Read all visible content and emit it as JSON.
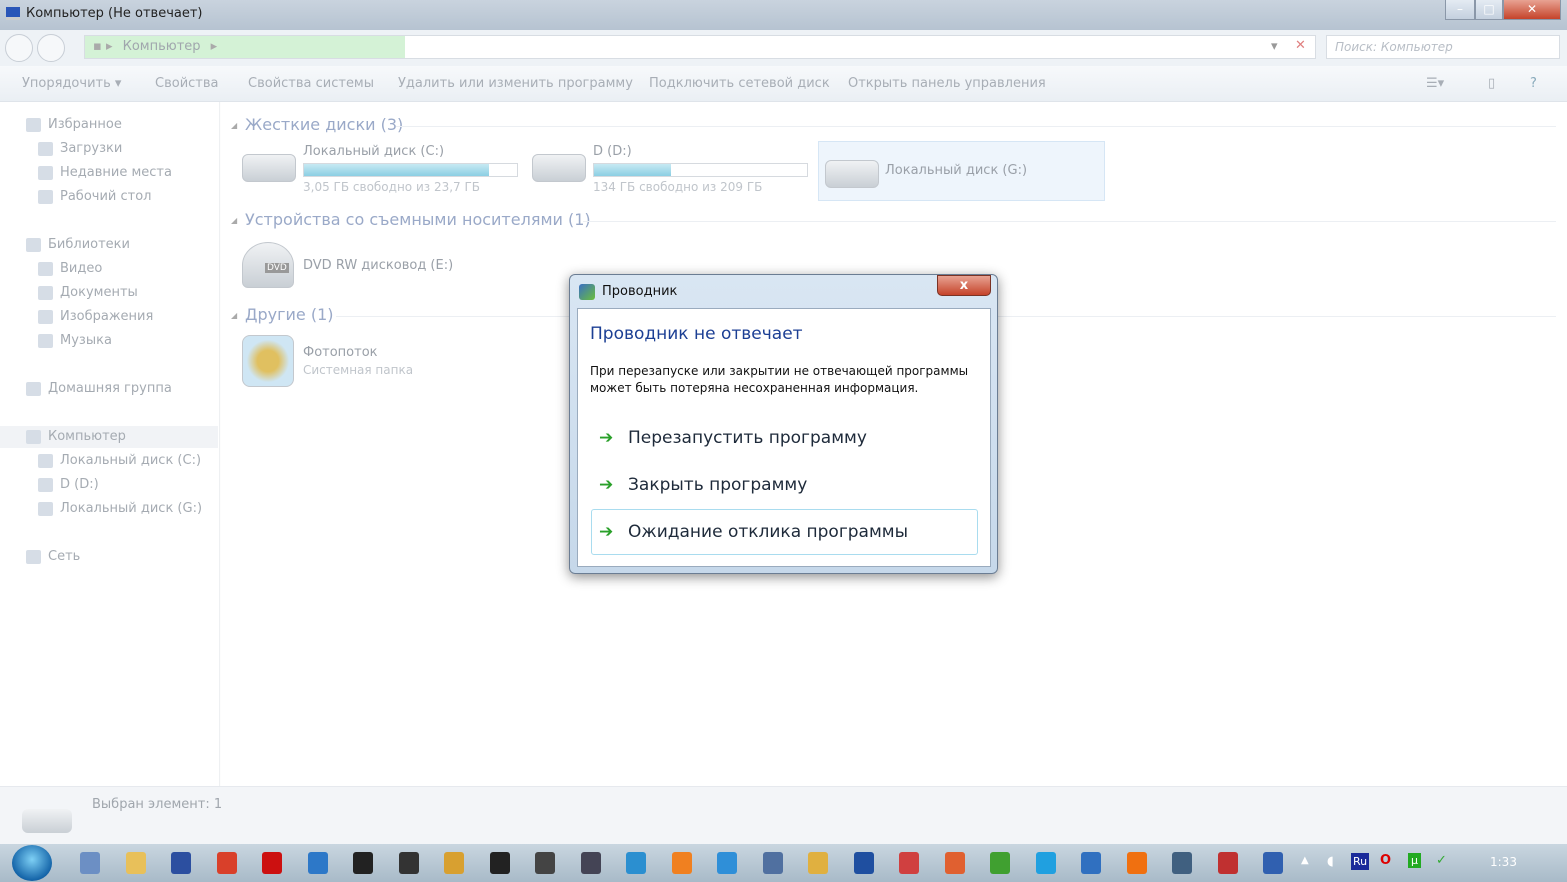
{
  "window": {
    "title": "Компьютер (Не отвечает)",
    "minimize": "–",
    "maximize": "□",
    "close": "✕"
  },
  "address": {
    "crumb": "Компьютер",
    "search_placeholder": "Поиск: Компьютер"
  },
  "toolbar": [
    "Упорядочить ▾",
    "Свойства",
    "Свойства системы",
    "Удалить или изменить программу",
    "Подключить сетевой диск",
    "Открыть панель управления"
  ],
  "sidebar": [
    {
      "label": "Избранное",
      "icon": "star-icon",
      "level": 0
    },
    {
      "label": "Загрузки",
      "icon": "downloads-folder-icon",
      "level": 1
    },
    {
      "label": "Недавние места",
      "icon": "recent-places-icon",
      "level": 1
    },
    {
      "label": "Рабочий стол",
      "icon": "desktop-icon",
      "level": 1
    },
    {
      "label": "Библиотеки",
      "icon": "libraries-icon",
      "level": 0
    },
    {
      "label": "Видео",
      "icon": "video-icon",
      "level": 1
    },
    {
      "label": "Документы",
      "icon": "documents-icon",
      "level": 1
    },
    {
      "label": "Изображения",
      "icon": "pictures-icon",
      "level": 1
    },
    {
      "label": "Музыка",
      "icon": "music-icon",
      "level": 1
    },
    {
      "label": "Домашняя группа",
      "icon": "homegroup-icon",
      "level": 0
    },
    {
      "label": "Компьютер",
      "icon": "computer-icon",
      "level": 0,
      "selected": true
    },
    {
      "label": "Локальный диск (C:)",
      "icon": "drive-icon",
      "level": 1
    },
    {
      "label": "D (D:)",
      "icon": "drive-icon",
      "level": 1
    },
    {
      "label": "Локальный диск (G:)",
      "icon": "drive-icon",
      "level": 1
    },
    {
      "label": "Сеть",
      "icon": "network-icon",
      "level": 0
    }
  ],
  "groups": {
    "hdd": "Жесткие диски (3)",
    "removable": "Устройства со съемными носителями (1)",
    "other": "Другие (1)"
  },
  "drives": [
    {
      "name": "Локальный диск (C:)",
      "free": "3,05 ГБ свободно из 23,7 ГБ",
      "used_percent": 87
    },
    {
      "name": "D (D:)",
      "free": "134 ГБ свободно из 209 ГБ",
      "used_percent": 36
    },
    {
      "name": "Локальный диск (G:)"
    }
  ],
  "dvd": {
    "name": "DVD RW дисковод (E:)",
    "badge": "DVD"
  },
  "photostream": {
    "name": "Фотопоток",
    "sub": "Системная папка"
  },
  "status": {
    "text": "Выбран элемент: 1"
  },
  "dialog": {
    "title": "Проводник",
    "close": "x",
    "heading": "Проводник не отвечает",
    "message": "При перезапуске или закрытии не отвечающей программы может быть потеряна несохраненная информация.",
    "options": [
      "Перезапустить программу",
      "Закрыть программу",
      "Ожидание отклика программы"
    ],
    "arrow": "➔"
  },
  "taskbar": {
    "clock": "1:33",
    "lang": "Ru",
    "apps": [
      "#6c8fc4",
      "#e8c05a",
      "#2c4fa0",
      "#d9402a",
      "#cc1010",
      "#2d78c8",
      "#222",
      "#333",
      "#d8a030",
      "#222",
      "#444",
      "#445",
      "#2b8fd0",
      "#f08020",
      "#2f8fd8",
      "#5070a0",
      "#e0b040",
      "#1f4fa0",
      "#d04040",
      "#e06030",
      "#40a030",
      "#20a0e0",
      "#3070c0",
      "#f07010",
      "#406080",
      "#c03030",
      "#3060b0"
    ]
  }
}
